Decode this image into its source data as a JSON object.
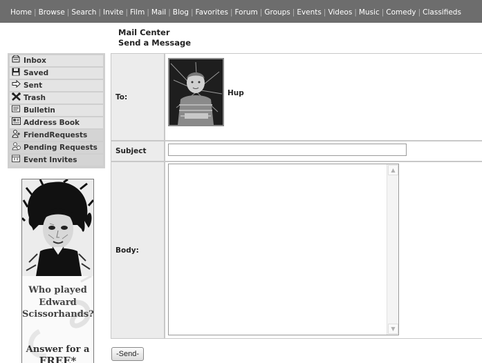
{
  "nav": {
    "items": [
      "Home",
      "Browse",
      "Search",
      "Invite",
      "Film",
      "Mail",
      "Blog",
      "Favorites",
      "Forum",
      "Groups",
      "Events",
      "Videos",
      "Music",
      "Comedy",
      "Classifieds"
    ]
  },
  "header": {
    "line1": "Mail Center",
    "line2": "Send a Message"
  },
  "sidebar": {
    "items": [
      {
        "label": "Inbox",
        "icon": "inbox-icon"
      },
      {
        "label": "Saved",
        "icon": "save-icon"
      },
      {
        "label": "Sent",
        "icon": "arrow-right-icon"
      },
      {
        "label": "Trash",
        "icon": "trash-icon"
      },
      {
        "label": "Bulletin",
        "icon": "bulletin-icon"
      },
      {
        "label": "Address Book",
        "icon": "address-book-icon"
      },
      {
        "label": "FriendRequests",
        "icon": "friend-request-icon"
      },
      {
        "label": "Pending Requests",
        "icon": "pending-request-icon"
      },
      {
        "label": "Event Invites",
        "icon": "event-invite-icon"
      }
    ]
  },
  "ad": {
    "question": "Who played Edward Scissorhands?",
    "answer_line1": "Answer for a",
    "answer_line2": "FREE*"
  },
  "form": {
    "to_label": "To:",
    "recipient_name": "Hup",
    "subject_label": "Subject",
    "subject_value": "",
    "body_label": "Body:",
    "body_value": ""
  },
  "send_label": "-Send-",
  "colors": {
    "nav_bg": "#6d6d6d",
    "sidebar_bg": "#cfcfcf",
    "label_bg": "#ececec",
    "grid": "#c8c8c8"
  }
}
